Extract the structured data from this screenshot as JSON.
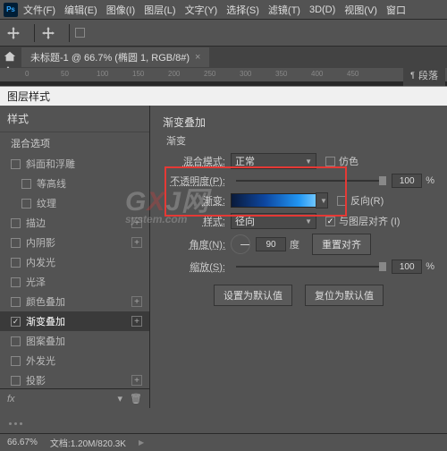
{
  "menu": {
    "items": [
      "文件(F)",
      "编辑(E)",
      "图像(I)",
      "图层(L)",
      "文字(Y)",
      "选择(S)",
      "滤镜(T)",
      "3D(D)",
      "视图(V)",
      "窗口"
    ]
  },
  "doc_tab": {
    "title": "未标题-1 @ 66.7% (椭圆 1, RGB/8#)"
  },
  "ruler_marks": [
    "0",
    "50",
    "100",
    "150",
    "200",
    "250",
    "300",
    "350",
    "400",
    "450"
  ],
  "right_panel_tab": "段落",
  "dialog_title": "图层样式",
  "styles": {
    "header": "样式",
    "blend_options": "混合选项",
    "items": [
      {
        "label": "斜面和浮雕",
        "checked": false,
        "plus": false
      },
      {
        "label": "等高线",
        "checked": false,
        "plus": false,
        "indent": true
      },
      {
        "label": "纹理",
        "checked": false,
        "plus": false,
        "indent": true
      },
      {
        "label": "描边",
        "checked": false,
        "plus": true
      },
      {
        "label": "内阴影",
        "checked": false,
        "plus": true
      },
      {
        "label": "内发光",
        "checked": false,
        "plus": false
      },
      {
        "label": "光泽",
        "checked": false,
        "plus": false
      },
      {
        "label": "颜色叠加",
        "checked": false,
        "plus": true
      },
      {
        "label": "渐变叠加",
        "checked": true,
        "plus": true,
        "selected": true
      },
      {
        "label": "图案叠加",
        "checked": false,
        "plus": false
      },
      {
        "label": "外发光",
        "checked": false,
        "plus": false
      },
      {
        "label": "投影",
        "checked": false,
        "plus": true
      }
    ],
    "footer_fx": "fx"
  },
  "gradient_overlay": {
    "section": "渐变叠加",
    "subsection": "渐变",
    "blend_mode_label": "混合模式:",
    "blend_mode_value": "正常",
    "dither_label": "仿色",
    "opacity_label": "不透明度(P):",
    "opacity_value": "100",
    "pct": "%",
    "gradient_label": "渐变:",
    "reverse_label": "反向(R)",
    "style_label": "样式:",
    "style_value": "径向",
    "align_label": "与图层对齐 (I)",
    "angle_label": "角度(N):",
    "angle_value": "90",
    "angle_unit": "度",
    "reset_align": "重置对齐",
    "scale_label": "缩放(S):",
    "scale_value": "100",
    "set_default": "设置为默认值",
    "reset_default": "复位为默认值"
  },
  "status": {
    "zoom": "66.67%",
    "doc_info": "文档:1.20M/820.3K"
  }
}
